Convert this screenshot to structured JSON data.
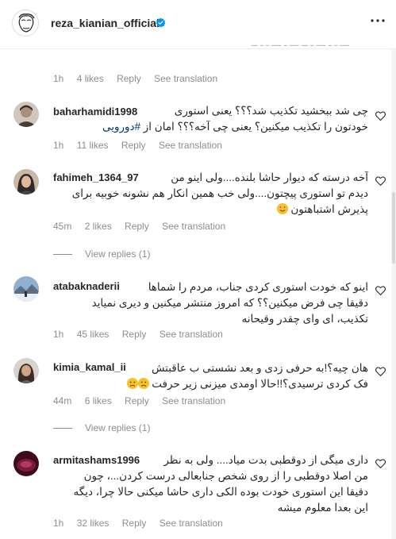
{
  "header": {
    "username": "reza_kianian_official",
    "verified_icon": "verified-badge-icon",
    "more_icon": "more-icon"
  },
  "comments": [
    {
      "time": "1h",
      "likes": "4 likes",
      "reply": "Reply",
      "translate": "See translation"
    },
    {
      "username": "baharhamidi1998",
      "text_line1": "چی شد ببخشید تکذیب شد؟؟؟ یعنی استوری",
      "text_line2_main": "خودتون را تکذیب میکنین؟ یعنی چی آخه؟؟؟ امان از ",
      "text_line2_tag": "#دورویی",
      "time": "1h",
      "likes": "11 likes",
      "reply": "Reply",
      "translate": "See translation"
    },
    {
      "username": "fahimeh_1364_97",
      "text_line1": "آخه درسته که دیوار حاشا بلنده....ولی اینو من",
      "text_line2": "دیدم تو استوری پیچتون....ولی خب همین انکار هم نشونه خوبیه برای",
      "text_line3": "پذیرش اشتباهتون",
      "time": "45m",
      "likes": "2 likes",
      "reply": "Reply",
      "translate": "See translation",
      "view_replies": "View replies (1)"
    },
    {
      "username": "atabaknaderii",
      "text_line1": "اینو که خودت استوری کردی جناب، مردم را شماها",
      "text_line2": "دقیقا چی فرض میکنین؟؟ که امروز منتشر میکنین و دیری نمیاید",
      "text_line3": "تکذیب، ای وای چقدر وقیحانه",
      "time": "1h",
      "likes": "45 likes",
      "reply": "Reply",
      "translate": "See translation"
    },
    {
      "username": "kimia_kamal_ii",
      "text_line1": "هان چیه؟!به حرفی زدی و بعد نشستی ب عاقبتش",
      "text_line2": "فک کردی ترسیدی؟!!حالا اومدی میزنی زیر حرفت",
      "time": "44m",
      "likes": "6 likes",
      "reply": "Reply",
      "translate": "See translation",
      "view_replies": "View replies (1)"
    },
    {
      "username": "armitashams1996",
      "text_line1": "داری میگی از دوقطبی بدت میاد.... ولی به نظر",
      "text_line2": "من اصلا دوقطبی را از روی شخص جنابعالی درست کردن...، چون",
      "text_line3": "دقیقا این استوری خودت بوده الکی داری حاشا میکنی حالا چرا، دیگه",
      "text_line4": "این بعدا معلوم میشه",
      "time": "1h",
      "likes": "32 likes",
      "reply": "Reply",
      "translate": "See translation"
    }
  ]
}
